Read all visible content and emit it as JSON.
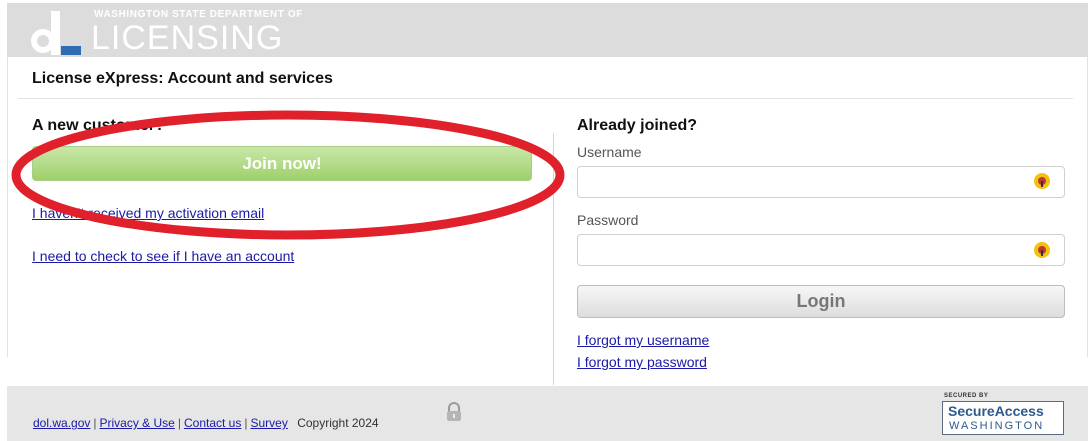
{
  "header": {
    "agency_line": "WASHINGTON STATE DEPARTMENT OF",
    "agency_word": "LICENSING",
    "logo_icon": "dol-logo-icon"
  },
  "page": {
    "title": "License eXpress: Account and services"
  },
  "new_customer": {
    "heading": "A new customer?",
    "join_label": "Join now!",
    "links": [
      "I haven't received my activation email",
      "I need to check to see if I have an account"
    ],
    "annotation_color": "#e0202a"
  },
  "login": {
    "heading": "Already joined?",
    "username_label": "Username",
    "username_value": "",
    "password_label": "Password",
    "password_value": "",
    "field_icon": "password-manager-key-icon",
    "login_label": "Login",
    "forgot_username": "I forgot my username",
    "forgot_password": "I forgot my password"
  },
  "footer": {
    "links": [
      "dol.wa.gov",
      "Privacy & Use",
      "Contact us",
      "Survey"
    ],
    "copyright": "Copyright 2024",
    "lock_icon": "lock-icon",
    "badge_top": "SECURED BY",
    "badge_main": "SecureAccess",
    "badge_sub": "WASHINGTON"
  },
  "colors": {
    "join_button": "#a7d474",
    "link": "#1a1aa6",
    "header_bg": "#dcdcdc"
  }
}
